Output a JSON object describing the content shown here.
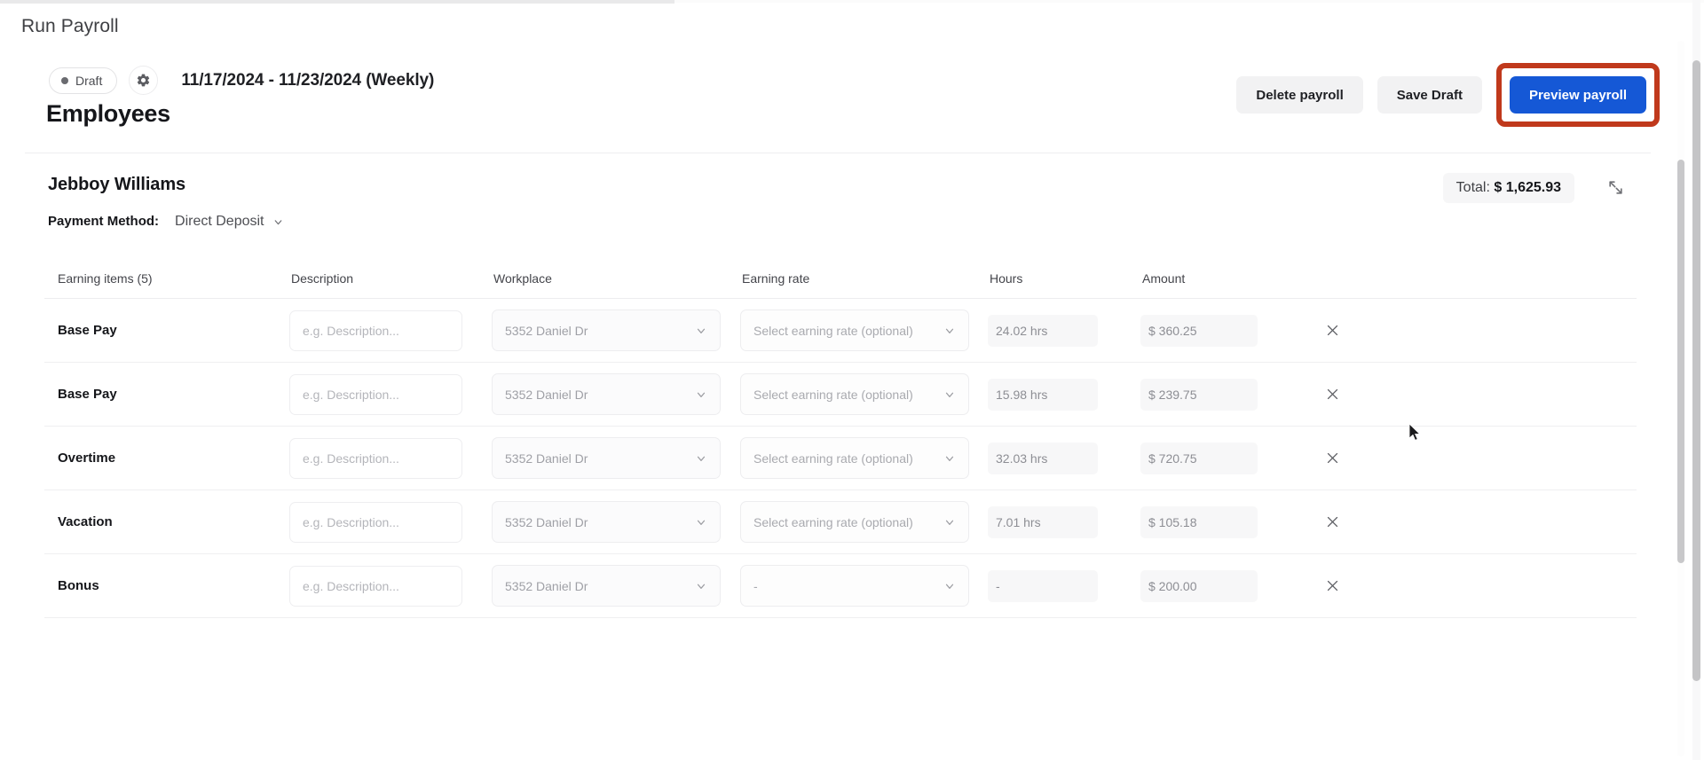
{
  "breadcrumb": "Run Payroll",
  "status": {
    "badge_label": "Draft",
    "gear_icon": "gear-icon",
    "period": "11/17/2024 - 11/23/2024 (Weekly)"
  },
  "header_actions": {
    "delete_label": "Delete payroll",
    "save_label": "Save Draft",
    "preview_label": "Preview payroll",
    "highlight_color": "#c0391c",
    "primary_color": "#1558d6"
  },
  "section": {
    "title": "Employees"
  },
  "employee": {
    "name": "Jebboy Williams",
    "payment_method_label": "Payment Method:",
    "payment_method_value": "Direct Deposit",
    "total_label": "Total:",
    "total_amount": "$ 1,625.93",
    "collapse_icon": "collapse-arrows-icon"
  },
  "table": {
    "headers": {
      "item": "Earning items (5)",
      "description": "Description",
      "workplace": "Workplace",
      "rate": "Earning rate",
      "hours": "Hours",
      "amount": "Amount"
    },
    "description_placeholder": "e.g. Description...",
    "rate_placeholder": "Select earning rate (optional)",
    "rows": [
      {
        "item": "Base Pay",
        "description": "",
        "workplace": "5352 Daniel Dr",
        "rate": "Select earning rate (optional)",
        "hours": "24.02 hrs",
        "amount": "$ 360.25"
      },
      {
        "item": "Base Pay",
        "description": "",
        "workplace": "5352 Daniel Dr",
        "rate": "Select earning rate (optional)",
        "hours": "15.98 hrs",
        "amount": "$ 239.75"
      },
      {
        "item": "Overtime",
        "description": "",
        "workplace": "5352 Daniel Dr",
        "rate": "Select earning rate (optional)",
        "hours": "32.03 hrs",
        "amount": "$ 720.75"
      },
      {
        "item": "Vacation",
        "description": "",
        "workplace": "5352 Daniel Dr",
        "rate": "Select earning rate (optional)",
        "hours": "7.01 hrs",
        "amount": "$ 105.18"
      },
      {
        "item": "Bonus",
        "description": "",
        "workplace": "5352 Daniel Dr",
        "rate": "-",
        "hours": "-",
        "amount": "$ 200.00"
      }
    ]
  }
}
